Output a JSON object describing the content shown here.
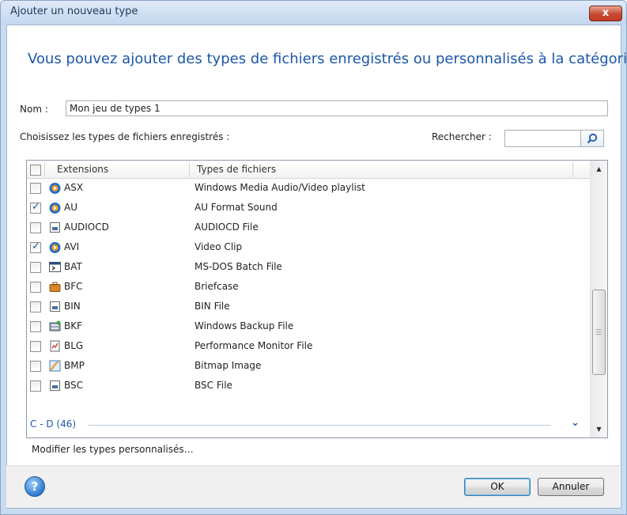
{
  "window": {
    "title": "Ajouter un nouveau type",
    "close_label": "x"
  },
  "headline": "Vous pouvez ajouter des types de fichiers enregistrés ou personnalisés à la catégorie.",
  "name_field": {
    "label": "Nom :",
    "value": "Mon jeu de types 1"
  },
  "registered_label": "Choisissez les types de fichiers enregistrés :",
  "search": {
    "label": "Rechercher :",
    "value": ""
  },
  "list": {
    "columns": [
      "Extensions",
      "Types de fichiers"
    ],
    "rows": [
      {
        "ext": "ASX",
        "type": "Windows Media Audio/Video playlist",
        "checked": false,
        "icon": "media-player-icon"
      },
      {
        "ext": "AU",
        "type": "AU Format Sound",
        "checked": true,
        "icon": "media-player-icon"
      },
      {
        "ext": "AUDIOCD",
        "type": "AUDIOCD File",
        "checked": false,
        "icon": "generic-file-icon"
      },
      {
        "ext": "AVI",
        "type": "Video Clip",
        "checked": true,
        "icon": "media-player-icon"
      },
      {
        "ext": "BAT",
        "type": "MS-DOS Batch File",
        "checked": false,
        "icon": "batch-file-icon"
      },
      {
        "ext": "BFC",
        "type": "Briefcase",
        "checked": false,
        "icon": "briefcase-icon"
      },
      {
        "ext": "BIN",
        "type": "BIN File",
        "checked": false,
        "icon": "generic-file-icon"
      },
      {
        "ext": "BKF",
        "type": "Windows Backup File",
        "checked": false,
        "icon": "backup-icon"
      },
      {
        "ext": "BLG",
        "type": "Performance Monitor File",
        "checked": false,
        "icon": "performance-file-icon"
      },
      {
        "ext": "BMP",
        "type": "Bitmap Image",
        "checked": false,
        "icon": "bitmap-icon"
      },
      {
        "ext": "BSC",
        "type": "BSC File",
        "checked": false,
        "icon": "generic-file-icon"
      }
    ],
    "group_label": "C - D (46)"
  },
  "modify_link": "Modifier les types personnalisés…",
  "buttons": {
    "ok": "OK",
    "cancel": "Annuler",
    "help": "?"
  },
  "colors": {
    "accent": "#1c57a8",
    "frame": "#c9dbf0"
  }
}
